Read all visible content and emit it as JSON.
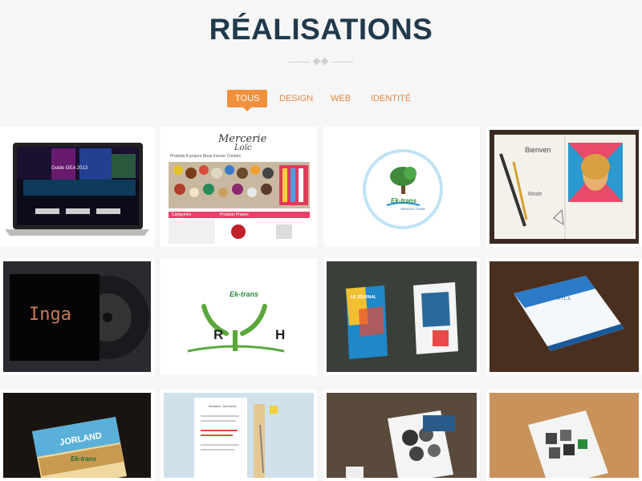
{
  "header": {
    "title": "RÉALISATIONS"
  },
  "filters": [
    {
      "label": "TOUS",
      "active": true
    },
    {
      "label": "DESIGN",
      "active": false
    },
    {
      "label": "WEB",
      "active": false
    },
    {
      "label": "IDENTITÉ",
      "active": false
    }
  ],
  "portfolio": {
    "items": [
      {
        "id": "laptop",
        "text": "Guide GEA 2013"
      },
      {
        "id": "mercerie",
        "brand_line1": "Mercerie",
        "brand_line2": "Loïc",
        "nav": "Produits  A propos  Nous trouver  Contact",
        "section1": "Catégories",
        "section2": "Produits Phares"
      },
      {
        "id": "ektrans-logo",
        "text": "Ek-trans",
        "subtext": "SERVICE GHISE"
      },
      {
        "id": "sketchbook",
        "text": "Bienven"
      },
      {
        "id": "inga",
        "text": "Inga"
      },
      {
        "id": "rh-logo",
        "brand": "Ek-trans",
        "letters": "R H"
      },
      {
        "id": "magazines",
        "text": "LE JOURNAL"
      },
      {
        "id": "brochure",
        "text": "G.T.L.S."
      },
      {
        "id": "jorland",
        "text": "JORLAND",
        "subtext": "Ek-trans"
      },
      {
        "id": "letter",
        "text": "Madame, Monsieur,"
      },
      {
        "id": "flyer",
        "text": ""
      },
      {
        "id": "booklet",
        "text": ""
      }
    ]
  },
  "colors": {
    "title": "#1f3a4d",
    "accent": "#f0913d",
    "background": "#f6f6f6"
  }
}
